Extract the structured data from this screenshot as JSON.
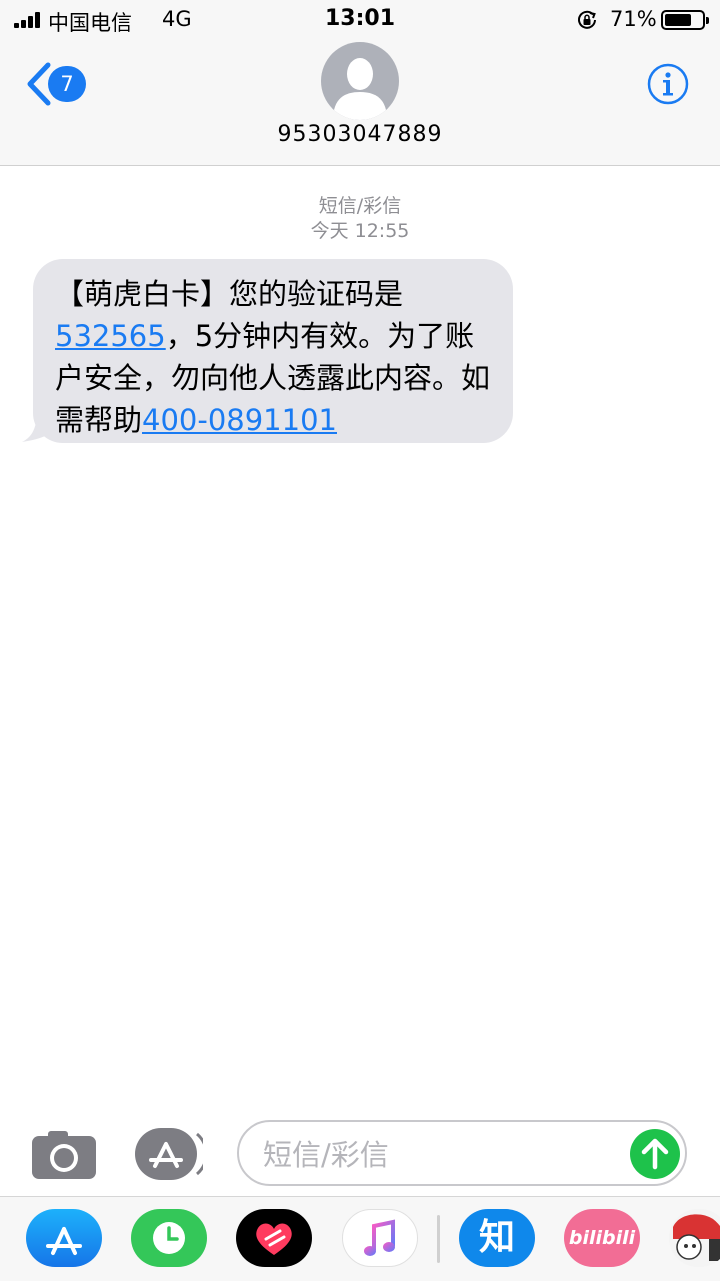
{
  "status_bar": {
    "carrier": "中国电信",
    "network": "4G",
    "time": "13:01",
    "battery_percent": "71%",
    "battery_level": 0.71
  },
  "header": {
    "back_badge": "7",
    "contact_number": "95303047889",
    "icons": [
      "back-chevron-icon",
      "avatar-icon",
      "info-icon"
    ]
  },
  "conversation": {
    "message_type": "短信/彩信",
    "timestamp": "今天 12:55",
    "message": {
      "part1": "【萌虎白卡】您的验证码是",
      "code_link": "532565",
      "part2": "，5分钟内有效。为了账户安全，勿向他人透露此内容。如需帮助",
      "phone_link": "400-0891101"
    }
  },
  "input_bar": {
    "placeholder": "短信/彩信",
    "value": "",
    "icons": [
      "camera-icon",
      "app-store-icon",
      "send-arrow-icon"
    ]
  },
  "app_drawer": {
    "zhihu_label": "知",
    "bilibili_label": "bilibili",
    "icons": [
      "app-store-icon",
      "activity-clock-icon",
      "heart-app-icon",
      "music-note-icon",
      "zhihu-icon",
      "bilibili-icon",
      "sticker-app-icon"
    ]
  },
  "colors": {
    "accent": "#1a7bf2",
    "bubble": "#e5e5ea",
    "send": "#1ec24b",
    "meta_text": "#8e8e93"
  }
}
